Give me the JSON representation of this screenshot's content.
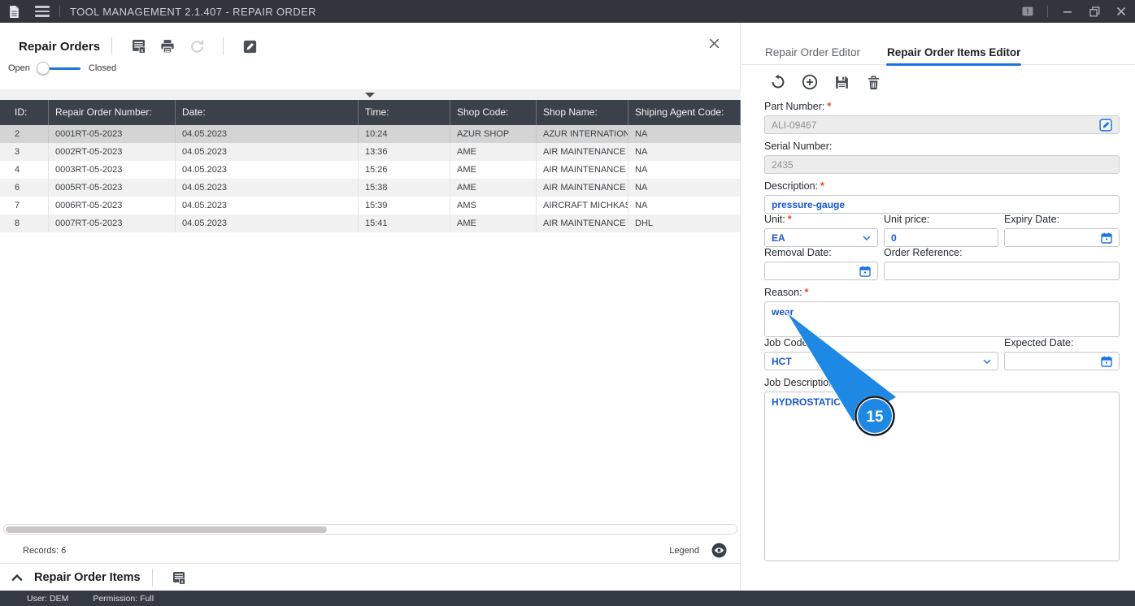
{
  "titlebar": {
    "title": "TOOL MANAGEMENT 2.1.407 - REPAIR ORDER"
  },
  "statusbar": {
    "user": "User: DEM",
    "permission": "Permission: Full"
  },
  "left_panel": {
    "title": "Repair Orders",
    "toggle": {
      "left_label": "Open",
      "right_label": "Closed",
      "state": "Open"
    },
    "table": {
      "columns": [
        "ID:",
        "Repair Order Number:",
        "Date:",
        "Time:",
        "Shop Code:",
        "Shop Name:",
        "Shiping Agent Code:"
      ],
      "rows": [
        [
          "2",
          "0001RT-05-2023",
          "04.05.2023",
          "10:24",
          "AZUR SHOP",
          "AZUR INTERNATION...",
          "NA"
        ],
        [
          "3",
          "0002RT-05-2023",
          "04.05.2023",
          "13:36",
          "AME",
          "AIR MAINTENANCE E...",
          "NA"
        ],
        [
          "4",
          "0003RT-05-2023",
          "04.05.2023",
          "15:26",
          "AME",
          "AIR MAINTENANCE E...",
          "NA"
        ],
        [
          "6",
          "0005RT-05-2023",
          "04.05.2023",
          "15:38",
          "AME",
          "AIR MAINTENANCE E...",
          "NA"
        ],
        [
          "7",
          "0006RT-05-2023",
          "04.05.2023",
          "15:39",
          "AMS",
          "AIRCRAFT MICHKAS...",
          "NA"
        ],
        [
          "8",
          "0007RT-05-2023",
          "04.05.2023",
          "15:41",
          "AME",
          "AIR MAINTENANCE E...",
          "DHL"
        ]
      ],
      "selected_row_index": 0
    },
    "footer": {
      "records": "Records: 6",
      "legend_label": "Legend"
    },
    "items_section": {
      "title": "Repair Order Items"
    }
  },
  "right_panel": {
    "tabs": [
      {
        "label": "Repair Order Editor"
      },
      {
        "label": "Repair Order Items Editor"
      }
    ],
    "active_tab": 1,
    "form": {
      "part_number": {
        "label": "Part Number:",
        "required": "*",
        "value": "ALI-09467"
      },
      "serial_number": {
        "label": "Serial Number:",
        "value": "2435"
      },
      "description": {
        "label": "Description:",
        "required": "*",
        "value": "pressure-gauge"
      },
      "unit": {
        "label": "Unit:",
        "required": "*",
        "value": "EA"
      },
      "unit_price": {
        "label": "Unit price:",
        "value": "0"
      },
      "expiry_date": {
        "label": "Expiry Date:",
        "value": ""
      },
      "removal_date": {
        "label": "Removal Date:",
        "value": ""
      },
      "order_reference": {
        "label": "Order Reference:",
        "value": ""
      },
      "reason": {
        "label": "Reason:",
        "required": "*",
        "value": "wear"
      },
      "job_code": {
        "label": "Job Code:",
        "value": "HCT"
      },
      "expected_date": {
        "label": "Expected Date:",
        "value": ""
      },
      "job_description": {
        "label": "Job Description:",
        "required": "*",
        "value": "HYDROSTATIC TEST"
      }
    }
  },
  "callout": {
    "step_number": "15"
  },
  "icons": {
    "titlebar": [
      "app-document-icon",
      "menu-hamburger-icon",
      "feedback-icon",
      "minimize-icon",
      "restore-icon",
      "close-icon"
    ],
    "orders_toolbar": [
      "export-excel-icon",
      "print-icon",
      "refresh-icon",
      "edit-icon"
    ],
    "items_editor_toolbar": [
      "undo-icon",
      "add-icon",
      "save-icon",
      "delete-icon"
    ],
    "misc": [
      "filter-collapse-icon",
      "part-number-edit-icon",
      "chevron-down-icon",
      "calendar-icon",
      "eye-icon",
      "chevron-up-icon",
      "export-excel-icon"
    ]
  },
  "colors": {
    "titlebar_bg": "#31353c",
    "table_header_bg": "#3b404a",
    "selected_row_bg": "#d4d4d4",
    "alt_row_bg": "#f1f1f1",
    "accent_blue": "#1a73e8",
    "value_text_blue": "#1757d6",
    "callout_blue": "#1e88e5",
    "required_red": "#e8442e"
  }
}
